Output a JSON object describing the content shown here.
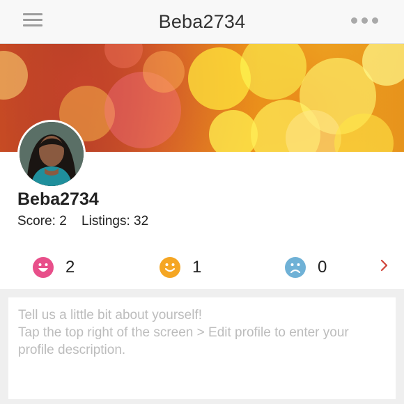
{
  "header": {
    "title": "Beba2734",
    "menu_icon": "hamburger-menu-icon",
    "more_icon": "more-dots-icon"
  },
  "profile": {
    "username": "Beba2734",
    "score_text": "Score: 2",
    "listings_text": "Listings: 32"
  },
  "ratings": {
    "positive": {
      "icon": "happy-face-icon",
      "count": "2",
      "color": "#e84f8a"
    },
    "neutral": {
      "icon": "smile-face-icon",
      "count": "1",
      "color": "#f5a623"
    },
    "negative": {
      "icon": "sad-face-icon",
      "count": "0",
      "color": "#6fb1d6"
    },
    "more_icon": "chevron-right-icon",
    "more_color": "#d0453a"
  },
  "about": {
    "placeholder": "Tell us a little bit about yourself!\nTap the top right of the screen > Edit profile to enter your profile description."
  }
}
